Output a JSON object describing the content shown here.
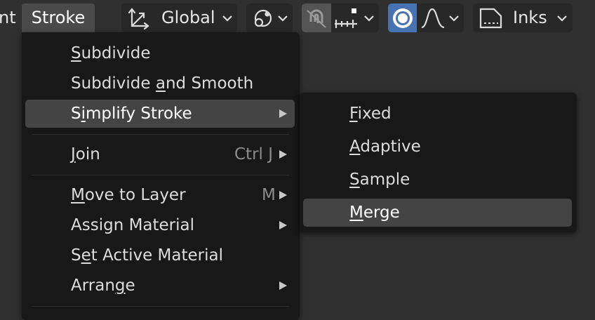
{
  "header": {
    "prev_menu_fragment": "nt",
    "stroke_menu": "Stroke",
    "transform_orientation": "Global",
    "layer_mode": "Inks"
  },
  "stroke_menu": {
    "items": [
      {
        "pre": "",
        "u": "S",
        "post": "ubdivide"
      },
      {
        "pre": "Subdivide ",
        "u": "a",
        "post": "nd Smooth"
      },
      {
        "pre": "S",
        "u": "i",
        "post": "mplify Stroke"
      },
      {
        "pre": "",
        "u": "J",
        "post": "oin",
        "shortcut": "Ctrl J"
      },
      {
        "pre": "",
        "u": "M",
        "post": "ove to Layer",
        "shortcut": "M"
      },
      {
        "pre": "Assign Material",
        "u": "",
        "post": ""
      },
      {
        "pre": "S",
        "u": "e",
        "post": "t Active Material"
      },
      {
        "pre": "Arran",
        "u": "g",
        "post": "e"
      }
    ]
  },
  "simplify_submenu": {
    "items": [
      {
        "pre": "",
        "u": "F",
        "post": "ixed"
      },
      {
        "pre": "",
        "u": "A",
        "post": "daptive"
      },
      {
        "pre": "",
        "u": "S",
        "post": "ample"
      },
      {
        "pre": "",
        "u": "M",
        "post": "erge"
      }
    ]
  },
  "colors": {
    "header_bg": "#303030",
    "menu_bg": "#181818",
    "highlight": "#444444",
    "accent_blue": "#4772b3"
  }
}
